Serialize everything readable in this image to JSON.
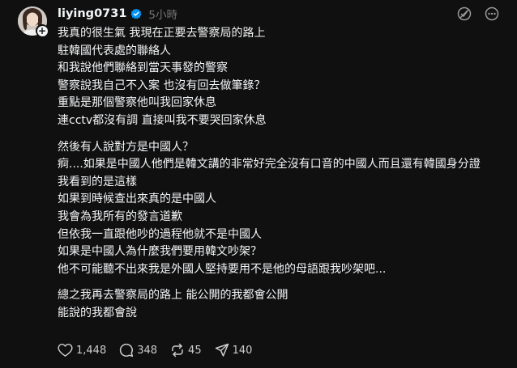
{
  "post": {
    "username": "liying0731",
    "timestamp": "5小時",
    "paragraphs": [
      [
        "我真的很生氣 我現在正要去警察局的路上",
        "駐韓國代表處的聯絡人",
        "和我說他們聯絡到當天事發的警察",
        "警察說我自己不入案 也沒有回去做筆錄？",
        "重點是那個警察他叫我回家休息",
        "連cctv都沒有調 直接叫我不要哭回家休息"
      ],
      [
        "然後有人說對方是中國人？",
        "痾....如果是中國人他們是韓文講的非常好完全沒有口音的中國人而且還有韓國身分證",
        "我看到的是這樣",
        "如果到時候查出來真的是中國人",
        "我會為我所有的發言道歉",
        "但依我一直跟他吵的過程他就不是中國人",
        "如果是中國人為什麼我們要用韓文吵架？",
        "他不可能聽不出來我是外國人堅持要用不是他的母語跟我吵架吧..."
      ],
      [
        "總之我再去警察局的路上 能公開的我都會公開",
        "能說的我都會說"
      ]
    ]
  },
  "stats": {
    "likes": "1,448",
    "replies": "348",
    "reposts": "45",
    "shares": "140"
  },
  "icons": {
    "verified": "verified-badge-icon",
    "top_right": [
      "translate-icon",
      "more-icon"
    ],
    "actions": [
      "heart-icon",
      "comment-icon",
      "repost-icon",
      "share-icon"
    ]
  },
  "colors": {
    "background": "#101010",
    "text": "#f3f5f7",
    "muted": "#777777",
    "verified": "#0095f6"
  }
}
